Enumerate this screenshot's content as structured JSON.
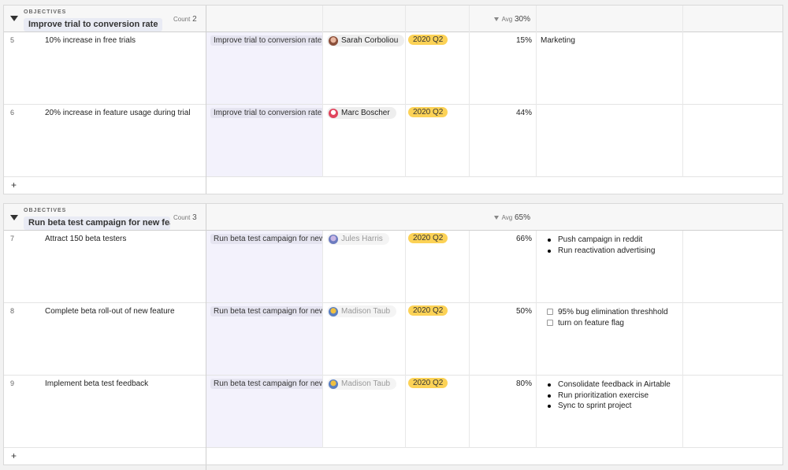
{
  "groups": [
    {
      "label": "OBJECTIVES",
      "name": "Improve trial to conversion rate",
      "count_label": "Count",
      "count": "2",
      "avg_label": "Avg",
      "avg": "30%",
      "rows": [
        {
          "num": "5",
          "name": "10% increase in free trials",
          "objective": "Improve trial to conversion rate",
          "owner": "Sarah Corboliou",
          "quarter": "2020 Q2",
          "percent": "15%",
          "notes": "Marketing"
        },
        {
          "num": "6",
          "name": "20% increase in feature usage during trial",
          "objective": "Improve trial to conversion rate",
          "owner": "Marc Boscher",
          "quarter": "2020 Q2",
          "percent": "44%",
          "notes": ""
        }
      ]
    },
    {
      "label": "OBJECTIVES",
      "name": "Run beta test campaign for new feature",
      "count_label": "Count",
      "count": "3",
      "avg_label": "Avg",
      "avg": "65%",
      "rows": [
        {
          "num": "7",
          "name": "Attract 150 beta testers",
          "objective": "Run beta test campaign for new feature",
          "owner": "Jules Harris",
          "quarter": "2020 Q2",
          "percent": "66%",
          "notes_list": [
            "Push campaign in reddit",
            "Run reactivation advertising"
          ]
        },
        {
          "num": "8",
          "name": "Complete beta roll-out of new feature",
          "objective": "Run beta test campaign for new feature",
          "owner": "Madison Taub",
          "quarter": "2020 Q2",
          "percent": "50%",
          "notes_checks": [
            "95% bug elimination threshhold",
            "turn on feature flag"
          ]
        },
        {
          "num": "9",
          "name": "Implement beta test feedback",
          "objective": "Run beta test campaign for new feature",
          "owner": "Madison Taub",
          "quarter": "2020 Q2",
          "percent": "80%",
          "notes_list": [
            "Consolidate feedback in Airtable",
            "Run prioritization exercise",
            "Sync to sprint project"
          ]
        }
      ]
    }
  ],
  "add_row_label": "+",
  "colors": {
    "quarter_badge": "#fcd256",
    "objective_column": "#f3f2fc"
  },
  "icons": {
    "collapse": "caret-down-icon",
    "add": "plus-icon"
  }
}
